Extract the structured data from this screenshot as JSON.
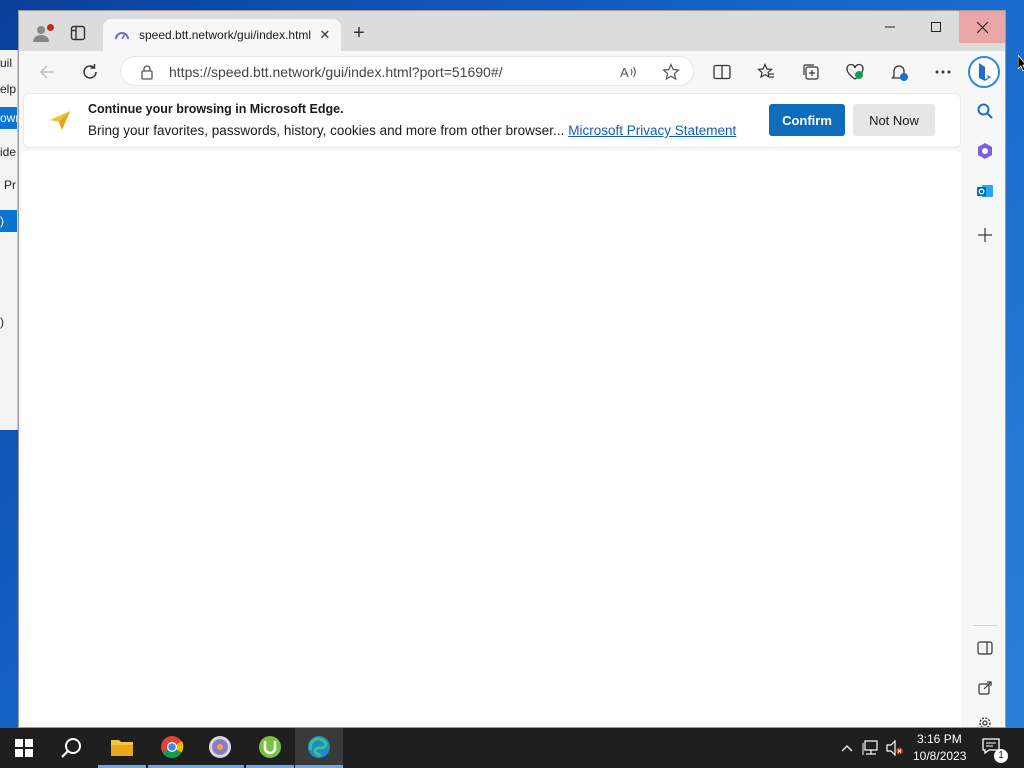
{
  "browser": {
    "tab_title": "speed.btt.network/gui/index.html",
    "url": "https://speed.btt.network/gui/index.html?port=51690#/"
  },
  "infobar": {
    "title": "Continue your browsing in Microsoft Edge.",
    "body": "Bring your favorites, passwords, history, cookies and more from other browser...",
    "link": "Microsoft Privacy Statement",
    "confirm_label": "Confirm",
    "not_now_label": "Not Now"
  },
  "background_window": {
    "fragments": [
      "uil",
      "elp",
      "own",
      "ide",
      "Pr",
      ")",
      ")"
    ]
  },
  "taskbar": {
    "time": "3:16 PM",
    "date": "10/8/2023",
    "notification_count": "1"
  },
  "colors": {
    "accent": "#0f6cbd",
    "link": "#1060b8",
    "taskbar": "#1f1f1f"
  }
}
